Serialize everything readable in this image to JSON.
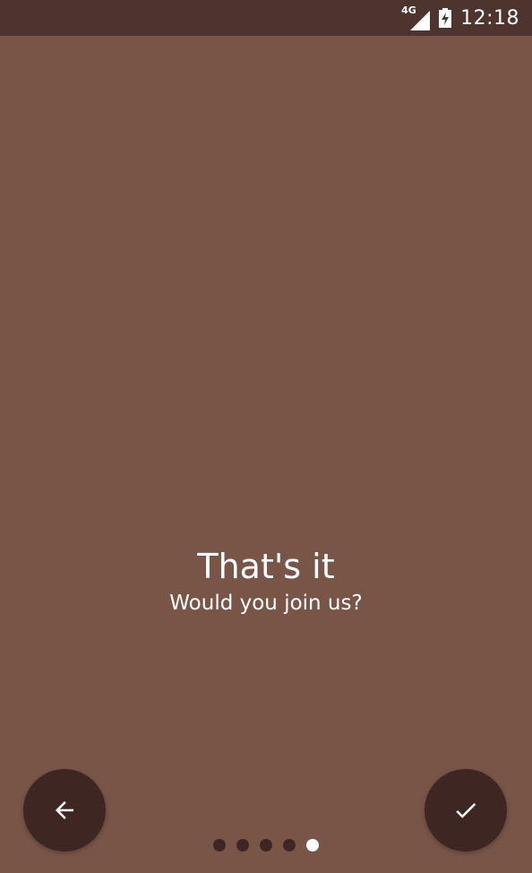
{
  "status_bar": {
    "network_label": "4G",
    "time": "12:18",
    "icons": [
      "signal-icon",
      "battery-icon"
    ]
  },
  "slide": {
    "title": "That's it",
    "subtitle": "Would you join us?"
  },
  "navigation": {
    "back_icon": "arrow-left-icon",
    "done_icon": "check-icon",
    "page_count": 5,
    "active_page": 5
  },
  "colors": {
    "background": "#795548",
    "status_bar": "#4e342e",
    "fab": "#3e2723",
    "dot_inactive": "#3e2723",
    "dot_active": "#ffffff",
    "text": "#ffffff"
  }
}
